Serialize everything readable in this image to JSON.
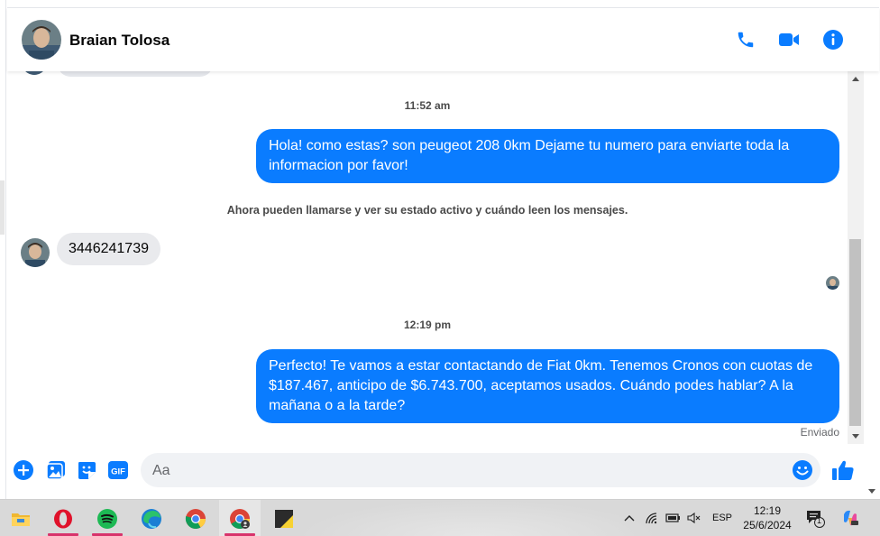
{
  "contact": {
    "name": "Braian Tolosa"
  },
  "header_actions": [
    "phone-icon",
    "video-call-icon",
    "info-icon"
  ],
  "messages": {
    "timestamp_1": "11:52 am",
    "outgoing_1": "Hola! como estas? son peugeot 208 0km Dejame tu numero para enviarte toda la informacion por favor!",
    "system_notice": "Ahora pueden llamarse y ver su estado activo y cuándo leen los mensajes.",
    "incoming_1": "3446241739",
    "timestamp_2": "12:19 pm",
    "outgoing_2": "Perfecto! Te vamos a estar contactando de Fiat 0km. Tenemos Cronos con cuotas de $187.467, anticipo de $6.743.700, aceptamos usados. Cuándo podes hablar? A la mañana o a la tarde?",
    "status": "Enviado"
  },
  "composer": {
    "placeholder": "Aa",
    "icons": [
      "plus-icon",
      "image-icon",
      "sticker-icon",
      "gif-icon",
      "emoji-icon",
      "like-icon"
    ],
    "gif_label": "GIF"
  },
  "colors": {
    "accent": "#0a7cff",
    "bubble_in": "#e9eaed",
    "taskbar": "#d9d9d9"
  },
  "taskbar": {
    "apps": [
      "file-explorer-icon",
      "opera-icon",
      "spotify-icon",
      "edge-icon",
      "chrome-icon",
      "chrome-profile-icon",
      "sticky-notes-icon"
    ],
    "language": "ESP",
    "time": "12:19",
    "date": "25/6/2024",
    "notification_count": "1"
  }
}
